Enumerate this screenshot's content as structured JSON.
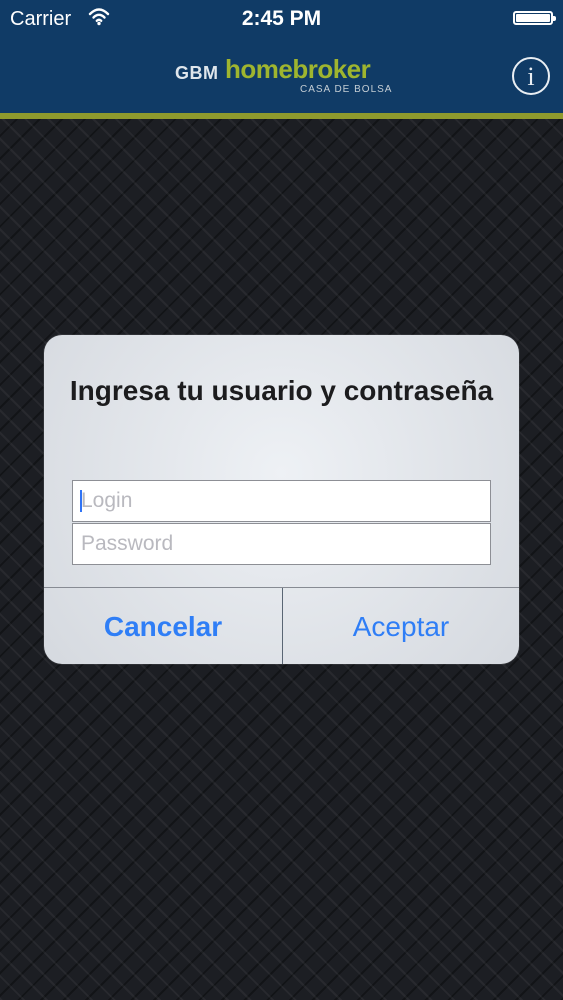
{
  "status_bar": {
    "carrier": "Carrier",
    "time": "2:45 PM",
    "icons": [
      "wifi-icon",
      "battery-icon"
    ]
  },
  "header": {
    "logo": {
      "prefix": "GBM",
      "main": "homebroker",
      "subtitle": "CASA DE BOLSA"
    },
    "info_icon": "info-icon",
    "colors": {
      "navbar": "#103b66",
      "accent_line": "#8f9a2d",
      "logo_green": "#9fb52f"
    }
  },
  "dialog": {
    "title": "Ingresa tu usuario y contraseña",
    "login_placeholder": "Login",
    "password_placeholder": "Password",
    "cancel_label": "Cancelar",
    "accept_label": "Aceptar",
    "button_color": "#2f7ef6"
  }
}
